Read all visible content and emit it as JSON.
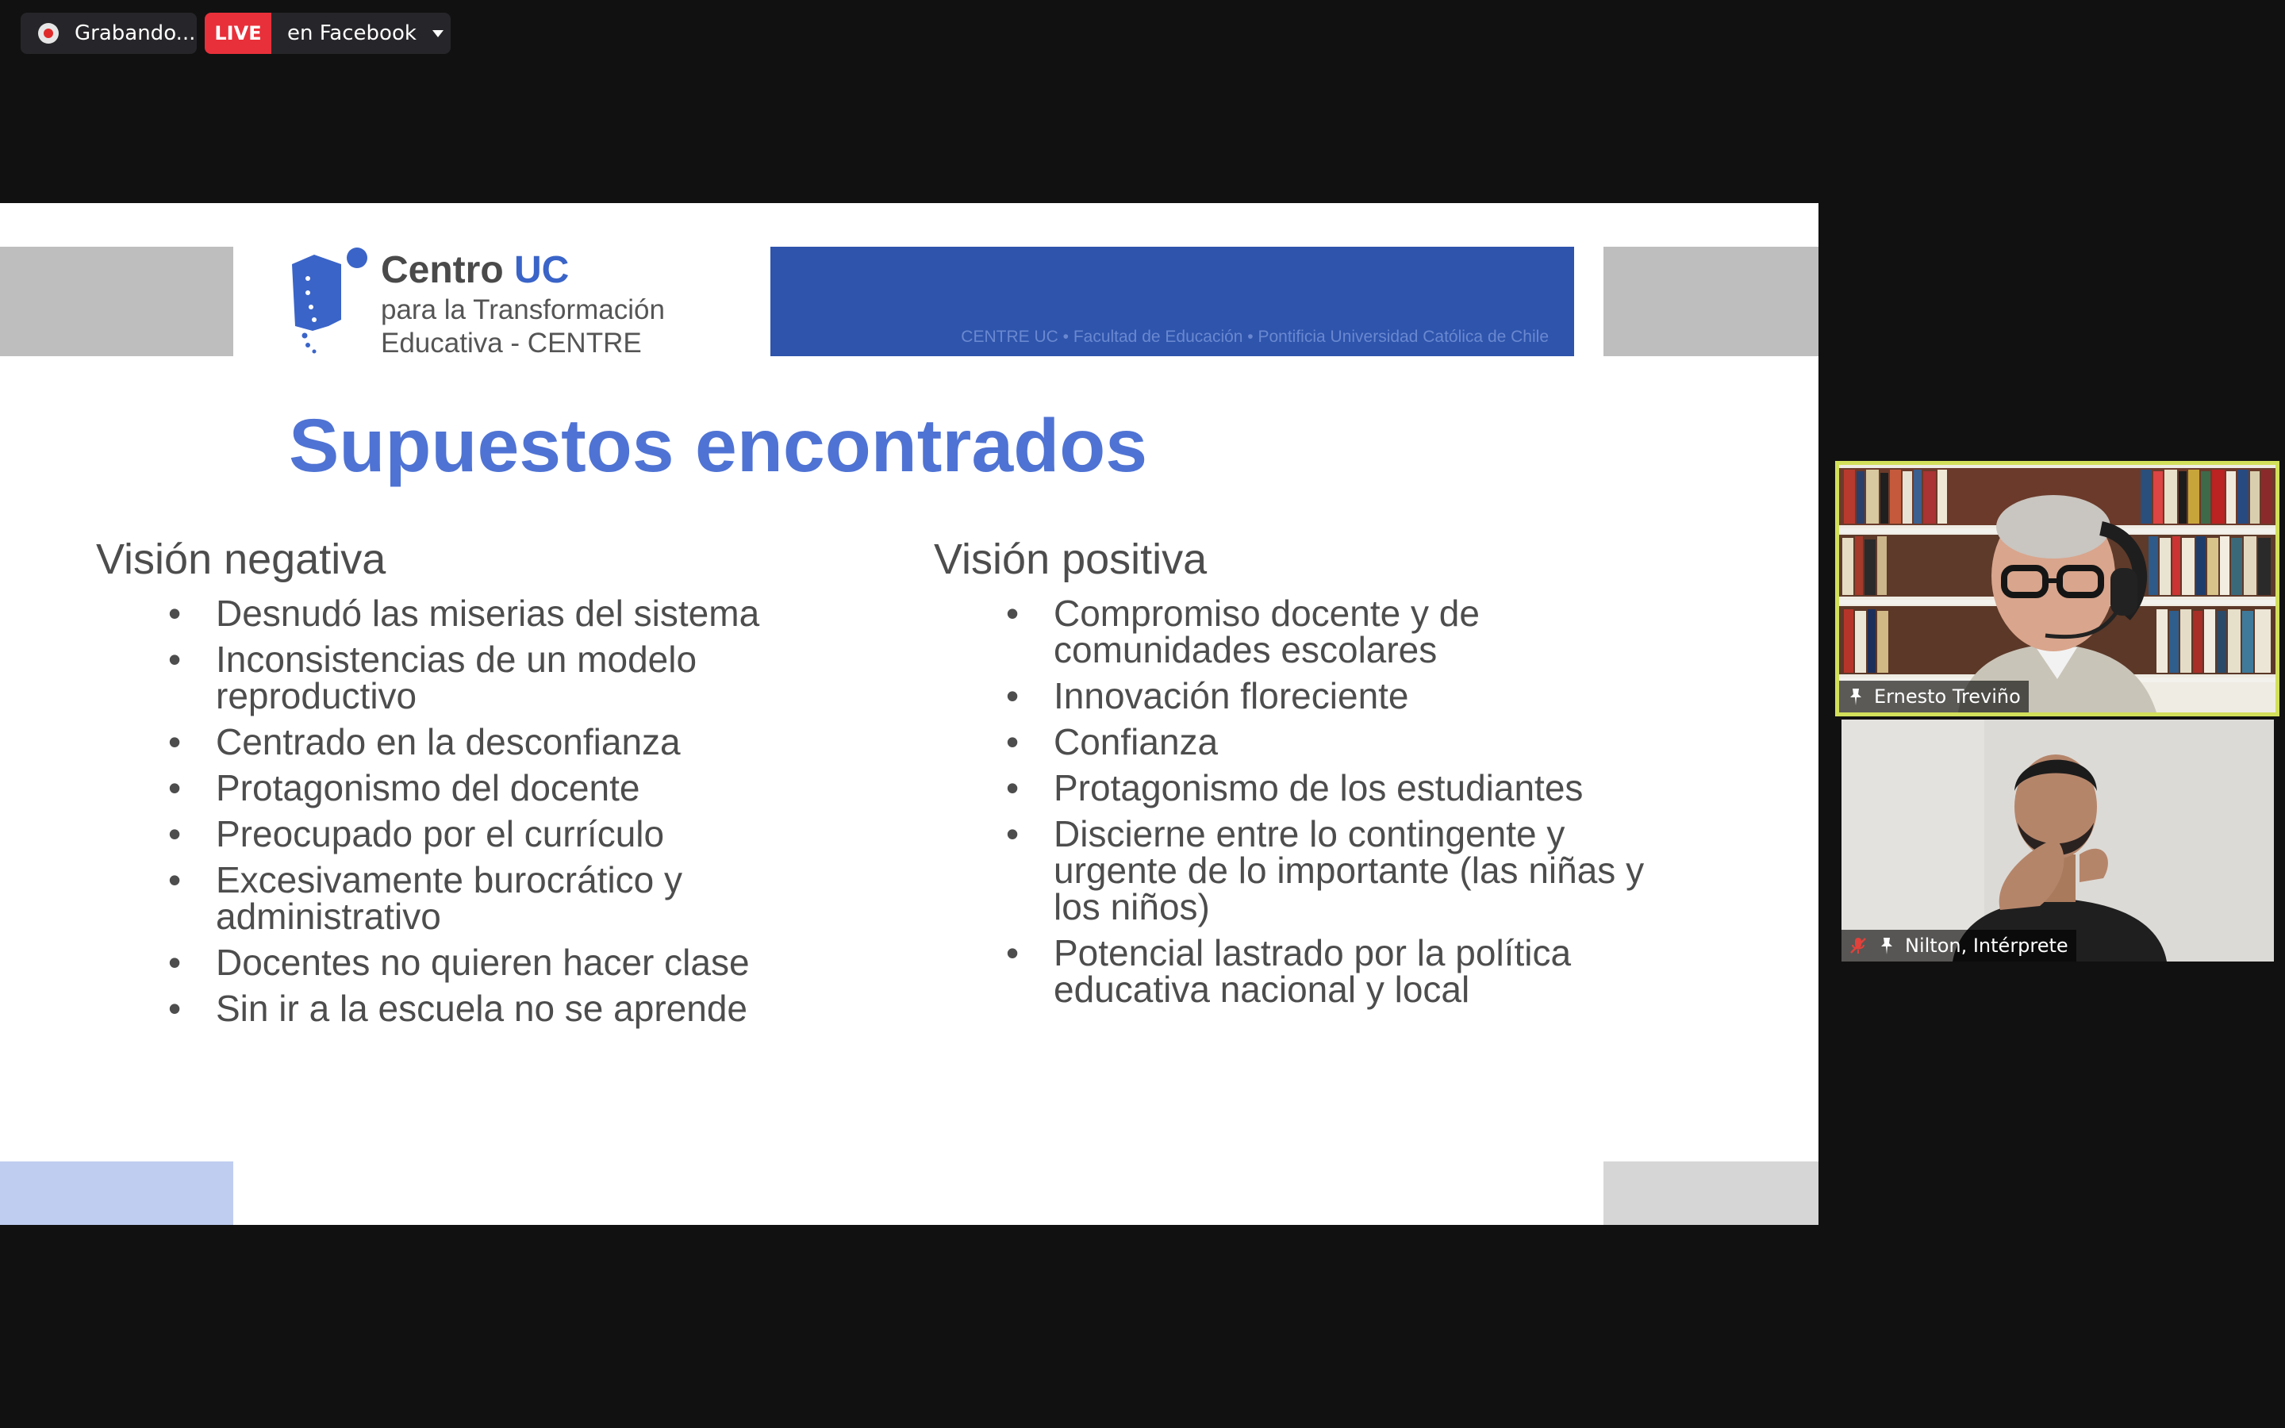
{
  "recording": {
    "label": "Grabando..."
  },
  "live": {
    "badge": "LIVE",
    "label": "en Facebook"
  },
  "slide": {
    "logo": {
      "title_a": "Centro ",
      "title_b": "UC",
      "line1": "para la Transformación",
      "line2": "Educativa - CENTRE"
    },
    "header_subtitle": "CENTRE UC  •  Facultad de Educación  •  Pontificia Universidad Católica de Chile",
    "title": "Supuestos encontrados",
    "left": {
      "heading": "Visión negativa",
      "items": [
        "Desnudó las miserias del sistema",
        "Inconsistencias de un modelo reproductivo",
        "Centrado en la desconfianza",
        "Protagonismo del docente",
        "Preocupado por el currículo",
        "Excesivamente burocrático y administrativo",
        "Docentes no quieren hacer clase",
        "Sin ir a la escuela no se aprende"
      ]
    },
    "right": {
      "heading": "Visión positiva",
      "items": [
        "Compromiso docente y de comunidades escolares",
        "Innovación floreciente",
        "Confianza",
        "Protagonismo de los estudiantes",
        "Discierne entre lo contingente y urgente de lo importante (las niñas y los niños)",
        "Potencial lastrado por la política educativa nacional y local"
      ]
    },
    "bullet": "•",
    "colors": {
      "title": "#4f73d4",
      "header_band": "#2e54ac",
      "text": "#4d4d4d"
    }
  },
  "participants": [
    {
      "name": "Ernesto Treviño",
      "active_speaker": true,
      "icons": [
        "pin-icon"
      ]
    },
    {
      "name": "Nilton, Intérprete",
      "active_speaker": false,
      "icons": [
        "mic-muted-icon",
        "pin-icon"
      ]
    }
  ]
}
